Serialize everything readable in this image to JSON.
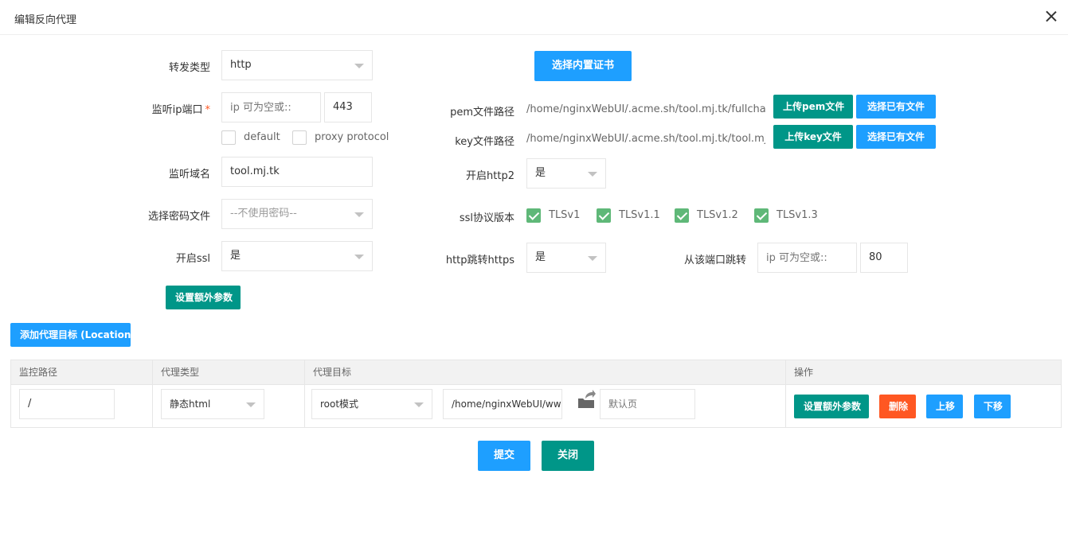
{
  "dialog": {
    "title": "编辑反向代理"
  },
  "form": {
    "forward_type": {
      "label": "转发类型",
      "value": "http"
    },
    "listen": {
      "label": "监听ip端口",
      "required_mark": "*",
      "ip_placeholder": "ip 可为空或::",
      "port": "443",
      "options": [
        {
          "label": "default",
          "checked": false
        },
        {
          "label": "proxy protocol",
          "checked": false
        }
      ]
    },
    "domain": {
      "label": "监听域名",
      "value": "tool.mj.tk"
    },
    "password_file": {
      "label": "选择密码文件",
      "value": "--不使用密码--"
    },
    "ssl": {
      "label": "开启ssl",
      "value": "是"
    },
    "extra_params_button": "设置额外参数"
  },
  "ssl_panel": {
    "builtin_cert_button": "选择内置证书",
    "pem": {
      "label": "pem文件路径",
      "value": "/home/nginxWebUI/.acme.sh/tool.mj.tk/fullcha...",
      "upload_button": "上传pem文件",
      "choose_button": "选择已有文件"
    },
    "key": {
      "label": "key文件路径",
      "value": "/home/nginxWebUI/.acme.sh/tool.mj.tk/tool.mj...",
      "upload_button": "上传key文件",
      "choose_button": "选择已有文件"
    },
    "http2": {
      "label": "开启http2",
      "value": "是"
    },
    "protocols": {
      "label": "ssl协议版本",
      "items": [
        {
          "label": "TLSv1",
          "checked": true
        },
        {
          "label": "TLSv1.1",
          "checked": true
        },
        {
          "label": "TLSv1.2",
          "checked": true
        },
        {
          "label": "TLSv1.3",
          "checked": true
        }
      ]
    },
    "http_redirect": {
      "label": "http跳转https",
      "value": "是"
    },
    "redirect_from": {
      "label": "从该端口跳转",
      "ip_placeholder": "ip 可为空或::",
      "port": "80"
    }
  },
  "locations": {
    "add_button": "添加代理目标 (Location)",
    "columns": [
      "监控路径",
      "代理类型",
      "代理目标",
      "操作"
    ],
    "rows": [
      {
        "path": "/",
        "proxy_type": "静态html",
        "target_mode": "root模式",
        "target_path": "/home/nginxWebUI/www/p",
        "default_page_placeholder": "默认页",
        "actions": {
          "extra": "设置额外参数",
          "delete": "删除",
          "up": "上移",
          "down": "下移"
        }
      }
    ]
  },
  "footer": {
    "submit": "提交",
    "close": "关闭"
  },
  "colors": {
    "primary_blue": "#1e9fff",
    "primary_green": "#009688",
    "danger": "#ff5722",
    "checkbox_checked": "#5fb878"
  },
  "icons": {
    "dialog_close": "close-icon",
    "upload_folder": "folder-upload-icon"
  }
}
